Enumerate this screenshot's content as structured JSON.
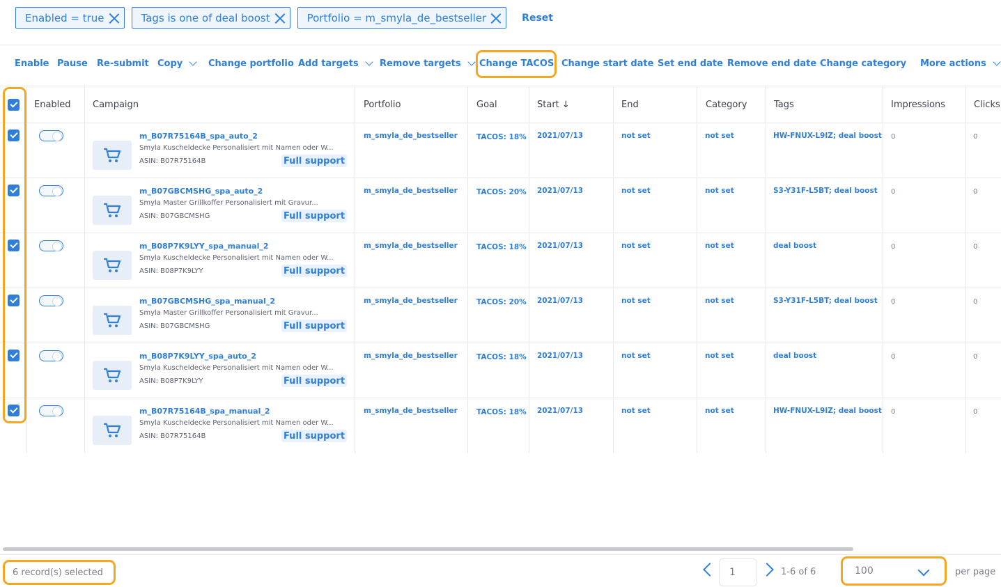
{
  "filters": {
    "chips": [
      "Enabled = true",
      "Tags is one of deal boost",
      "Portfolio = m_smyla_de_bestseller"
    ],
    "reset_label": "Reset"
  },
  "toolbar": {
    "actions": [
      {
        "label": "Enable",
        "dropdown": false
      },
      {
        "label": "Pause",
        "dropdown": false
      },
      {
        "label": "Re-submit",
        "dropdown": false
      },
      {
        "label": "Copy",
        "dropdown": true
      },
      {
        "label": "Change portfolio",
        "dropdown": false
      },
      {
        "label": "Add targets",
        "dropdown": true
      },
      {
        "label": "Remove targets",
        "dropdown": true
      },
      {
        "label": "Change TACOS",
        "dropdown": false
      },
      {
        "label": "Change start date",
        "dropdown": false
      },
      {
        "label": "Set end date",
        "dropdown": false
      },
      {
        "label": "Remove end date",
        "dropdown": false
      },
      {
        "label": "Change category",
        "dropdown": false
      },
      {
        "label": "More actions",
        "dropdown": true
      }
    ]
  },
  "table": {
    "columns": [
      "Enabled",
      "Campaign",
      "Portfolio",
      "Goal",
      "Start ↓",
      "End",
      "Category",
      "Tags",
      "Impressions",
      "Clicks"
    ],
    "rows": [
      {
        "selected": true,
        "enabled": true,
        "name": "m_B07R75164B_spa_auto_2",
        "description": "Smyla Kuscheldecke Personalisiert mit Namen oder W...",
        "asin": "ASIN: B07R75164B",
        "support": "Full support",
        "portfolio": "m_smyla_de_bestseller",
        "goal": "TACOS: 18%",
        "start": "2021/07/13",
        "end": "not set",
        "category": "not set",
        "tags": "HW-FNUX-L9IZ; deal boost",
        "impressions": "0",
        "clicks": "0"
      },
      {
        "selected": true,
        "enabled": true,
        "name": "m_B07GBCMSHG_spa_auto_2",
        "description": "Smyla Master Grillkoffer Personalisiert mit Gravur...",
        "asin": "ASIN: B07GBCMSHG",
        "support": "Full support",
        "portfolio": "m_smyla_de_bestseller",
        "goal": "TACOS: 20%",
        "start": "2021/07/13",
        "end": "not set",
        "category": "not set",
        "tags": "S3-Y31F-L5BT; deal boost",
        "impressions": "0",
        "clicks": "0"
      },
      {
        "selected": true,
        "enabled": true,
        "name": "m_B08P7K9LYY_spa_manual_2",
        "description": "Smyla Kuscheldecke Personalisiert mit Namen oder W...",
        "asin": "ASIN: B08P7K9LYY",
        "support": "Full support",
        "portfolio": "m_smyla_de_bestseller",
        "goal": "TACOS: 18%",
        "start": "2021/07/13",
        "end": "not set",
        "category": "not set",
        "tags": "deal boost",
        "impressions": "0",
        "clicks": "0"
      },
      {
        "selected": true,
        "enabled": true,
        "name": "m_B07GBCMSHG_spa_manual_2",
        "description": "Smyla Master Grillkoffer Personalisiert mit Gravur...",
        "asin": "ASIN: B07GBCMSHG",
        "support": "Full support",
        "portfolio": "m_smyla_de_bestseller",
        "goal": "TACOS: 20%",
        "start": "2021/07/13",
        "end": "not set",
        "category": "not set",
        "tags": "S3-Y31F-L5BT; deal boost",
        "impressions": "0",
        "clicks": "0"
      },
      {
        "selected": true,
        "enabled": true,
        "name": "m_B08P7K9LYY_spa_auto_2",
        "description": "Smyla Kuscheldecke Personalisiert mit Namen oder W...",
        "asin": "ASIN: B08P7K9LYY",
        "support": "Full support",
        "portfolio": "m_smyla_de_bestseller",
        "goal": "TACOS: 18%",
        "start": "2021/07/13",
        "end": "not set",
        "category": "not set",
        "tags": "deal boost",
        "impressions": "0",
        "clicks": "0"
      },
      {
        "selected": true,
        "enabled": true,
        "name": "m_B07R75164B_spa_manual_2",
        "description": "Smyla Kuscheldecke Personalisiert mit Namen oder W...",
        "asin": "ASIN: B07R75164B",
        "support": "Full support",
        "portfolio": "m_smyla_de_bestseller",
        "goal": "TACOS: 18%",
        "start": "2021/07/13",
        "end": "not set",
        "category": "not set",
        "tags": "HW-FNUX-L9IZ; deal boost",
        "impressions": "0",
        "clicks": "0"
      }
    ]
  },
  "footer": {
    "selected_text": "6 record(s) selected",
    "page": "1",
    "range": "1-6 of 6",
    "per_page_value": "100",
    "per_page_label": "per page"
  },
  "colors": {
    "accent": "#2f7fd9",
    "highlight": "#f5a623",
    "border": "#e6e9ee"
  }
}
